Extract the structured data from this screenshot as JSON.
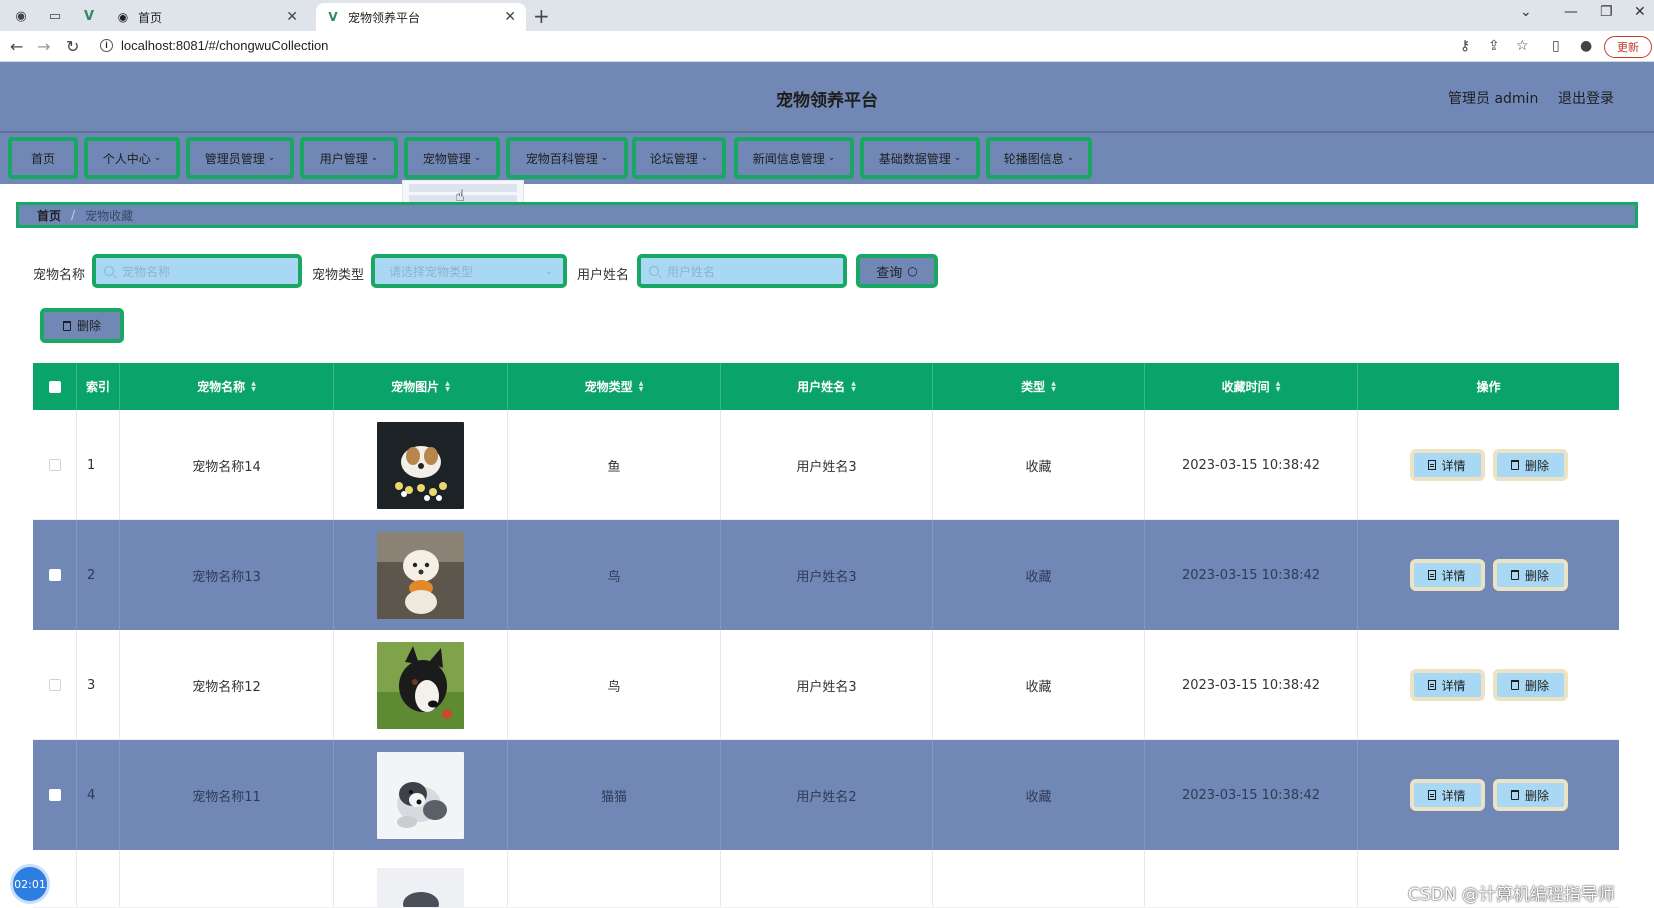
{
  "browser": {
    "tabs": [
      {
        "label": "首页",
        "active": false
      },
      {
        "label": "宠物领养平台",
        "active": true
      }
    ],
    "url": "localhost:8081/#/chongwuCollection",
    "update_label": "更新"
  },
  "header": {
    "title": "宠物领养平台",
    "user_label": "管理员 admin",
    "logout_label": "退出登录"
  },
  "menu": [
    {
      "label": "首页",
      "has_caret": false
    },
    {
      "label": "个人中心",
      "has_caret": true
    },
    {
      "label": "管理员管理",
      "has_caret": true
    },
    {
      "label": "用户管理",
      "has_caret": true
    },
    {
      "label": "宠物管理",
      "has_caret": true
    },
    {
      "label": "宠物百科管理",
      "has_caret": true
    },
    {
      "label": "论坛管理",
      "has_caret": true
    },
    {
      "label": "新闻信息管理",
      "has_caret": true
    },
    {
      "label": "基础数据管理",
      "has_caret": true
    },
    {
      "label": "轮播图信息",
      "has_caret": true
    }
  ],
  "breadcrumb": {
    "home": "首页",
    "separator": "/",
    "current": "宠物收藏"
  },
  "search": {
    "pet_name_label": "宠物名称",
    "pet_name_placeholder": "宠物名称",
    "pet_type_label": "宠物类型",
    "pet_type_placeholder": "请选择宠物类型",
    "user_name_label": "用户姓名",
    "user_name_placeholder": "用户姓名",
    "query_label": "查询"
  },
  "toolbar": {
    "delete_label": "删除"
  },
  "table": {
    "columns": [
      "索引",
      "宠物名称",
      "宠物图片",
      "宠物类型",
      "用户姓名",
      "类型",
      "收藏时间",
      "操作"
    ],
    "rows": [
      {
        "index": "1",
        "pet_name": "宠物名称14",
        "pet_type": "鱼",
        "user_name": "用户姓名3",
        "kind": "收藏",
        "time": "2023-03-15 10:38:42",
        "photo": "white-brown-puppy-with-flowers"
      },
      {
        "index": "2",
        "pet_name": "宠物名称13",
        "pet_type": "鸟",
        "user_name": "用户姓名3",
        "kind": "收藏",
        "time": "2023-03-15 10:38:42",
        "photo": "white-puppy-orange-bib"
      },
      {
        "index": "3",
        "pet_name": "宠物名称12",
        "pet_type": "鸟",
        "user_name": "用户姓名3",
        "kind": "收藏",
        "time": "2023-03-15 10:38:42",
        "photo": "black-white-dog-closeup"
      },
      {
        "index": "4",
        "pet_name": "宠物名称11",
        "pet_type": "猫猫",
        "user_name": "用户姓名2",
        "kind": "收藏",
        "time": "2023-03-15 10:38:42",
        "photo": "grey-white-puppy"
      }
    ],
    "detail_label": "详情",
    "row_delete_label": "删除"
  },
  "overlay": {
    "timer": "02:01",
    "watermark": "CSDN @计算机编程指导师"
  },
  "colors": {
    "header_bg": "#7188b6",
    "accent_border": "#19a864",
    "table_header": "#0aa36a",
    "input_bg": "#a8d8f3",
    "op_border": "#ece3c4"
  }
}
